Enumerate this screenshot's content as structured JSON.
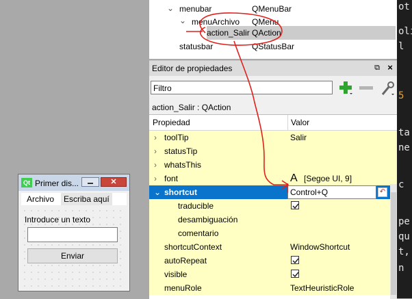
{
  "code_panel": {
    "lines": [
      "ot",
      "oli",
      "l",
      "5",
      "ta",
      "ne",
      "c",
      "pe",
      "qu",
      "t,",
      "n"
    ]
  },
  "object_tree": {
    "rows": [
      {
        "name": "menubar",
        "class": "QMenuBar"
      },
      {
        "name": "menuArchivo",
        "class": "QMenu"
      },
      {
        "name": "action_Salir",
        "class": "QAction"
      },
      {
        "name": "statusbar",
        "class": "QStatusBar"
      }
    ]
  },
  "property_editor": {
    "title": "Editor de propiedades",
    "filter_value": "Filtro",
    "object_class": "action_Salir : QAction",
    "col_property": "Propiedad",
    "col_value": "Valor",
    "rows": [
      {
        "name": "toolTip",
        "value": "Salir"
      },
      {
        "name": "statusTip",
        "value": ""
      },
      {
        "name": "whatsThis",
        "value": ""
      },
      {
        "name": "font",
        "value": "[Segoe UI, 9]",
        "font_glyph": "A"
      },
      {
        "name": "shortcut",
        "value": "Control+Q"
      },
      {
        "name": "traducible",
        "checked": true
      },
      {
        "name": "desambiguación",
        "value": ""
      },
      {
        "name": "comentario",
        "value": ""
      },
      {
        "name": "shortcutContext",
        "value": "WindowShortcut"
      },
      {
        "name": "autoRepeat",
        "checked": true
      },
      {
        "name": "visible",
        "checked": true
      },
      {
        "name": "menuRole",
        "value": "TextHeuristicRole"
      }
    ]
  },
  "form_window": {
    "title": "Primer dis...",
    "icon_label": "Qt",
    "menu": [
      "Archivo",
      "Escriba aquí"
    ],
    "label": "Introduce un texto",
    "button": "Enviar"
  },
  "colors": {
    "selection": "#0a74cc",
    "row_yellow": "#ffffc4",
    "annotation": "#e0201b"
  }
}
